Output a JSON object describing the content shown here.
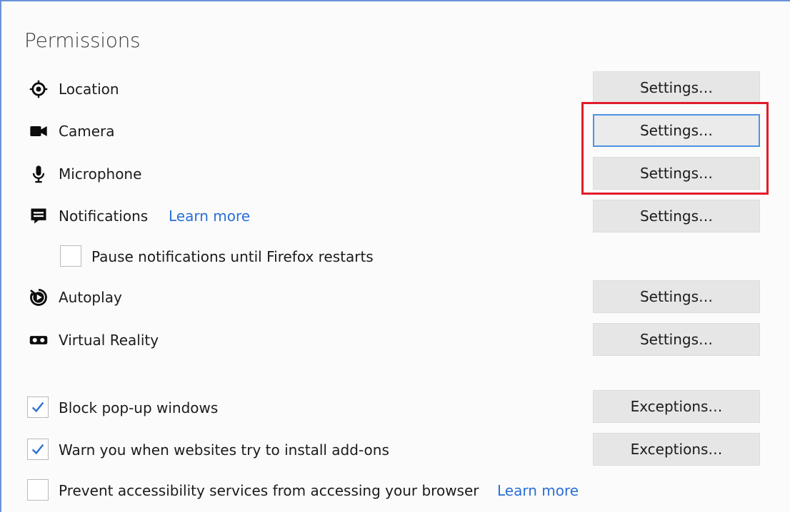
{
  "section": {
    "title": "Permissions"
  },
  "rows": [
    {
      "label": "Location",
      "icon": "location-icon",
      "button": "Settings…"
    },
    {
      "label": "Camera",
      "icon": "camera-icon",
      "button": "Settings…"
    },
    {
      "label": "Microphone",
      "icon": "microphone-icon",
      "button": "Settings…"
    },
    {
      "label": "Notifications",
      "icon": "notifications-icon",
      "button": "Settings…",
      "link": "Learn more"
    },
    {
      "label": "Autoplay",
      "icon": "autoplay-icon",
      "button": "Settings…"
    },
    {
      "label": "Virtual Reality",
      "icon": "virtual-reality-icon",
      "button": "Settings…"
    }
  ],
  "pause_notifications": {
    "label": "Pause notifications until Firefox restarts",
    "checked": false
  },
  "block_popups": {
    "label": "Block pop-up windows",
    "checked": true,
    "button": "Exceptions…"
  },
  "warn_addons": {
    "label": "Warn you when websites try to install add-ons",
    "checked": true,
    "button": "Exceptions…"
  },
  "prevent_accessibility": {
    "label": "Prevent accessibility services from accessing your browser",
    "checked": false,
    "link": "Learn more"
  },
  "colors": {
    "link": "#2a6fd6",
    "highlight": "#e21b2b",
    "focus": "#4b93e5",
    "check": "#2a6fd6"
  }
}
